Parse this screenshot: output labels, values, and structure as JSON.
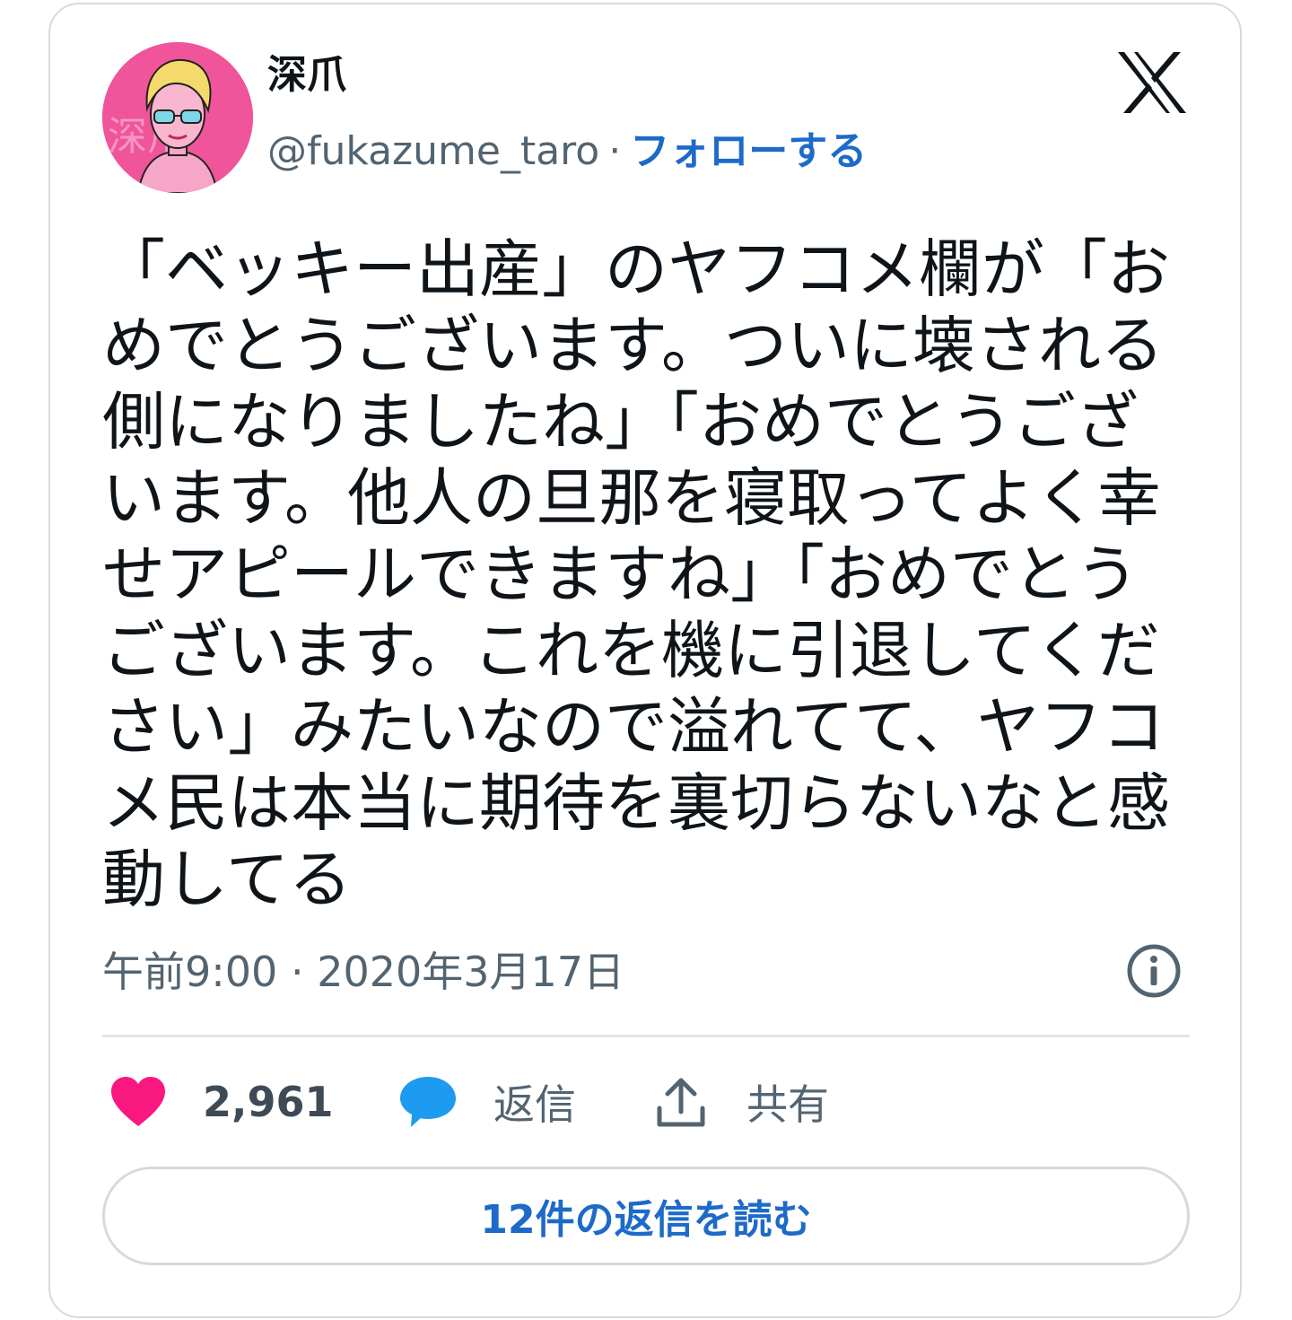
{
  "tweet": {
    "author": {
      "display_name": "深爪",
      "handle": "@fukazume_taro",
      "separator": "·",
      "follow_label": "フォローする",
      "avatar_overlay_text": "深爪"
    },
    "text_lines": [
      "「ベッキー出産」のヤフコメ欄が「お",
      "めでとうございます。ついに壊される",
      "側になりましたね」「おめでとうござ",
      "います。他人の旦那を寝取ってよく幸",
      "せアピールできますね」「おめでとう",
      "ございます。これを機に引退してくだ",
      "さい」みたいなので溢れてて、ヤフコ",
      "メ民は本当に期待を裏切らないなと感",
      "動してる"
    ],
    "time": "午前9:00",
    "meta_separator": "·",
    "date": "2020年3月17日",
    "actions": {
      "likes_count": "2,961",
      "reply_label": "返信",
      "share_label": "共有"
    },
    "read_replies_label": "12件の返信を読む"
  },
  "icons": {
    "brand": "x-logo-icon",
    "info": "info-icon",
    "like": "heart-icon",
    "reply": "speech-bubble-icon",
    "share": "share-upload-icon"
  },
  "colors": {
    "follow_link": "#1d6ac9",
    "heart": "#f91880",
    "reply_bubble": "#1d9bf0",
    "avatar_background": "#f0549a",
    "text_primary": "#0f1419",
    "text_secondary": "#536471"
  }
}
